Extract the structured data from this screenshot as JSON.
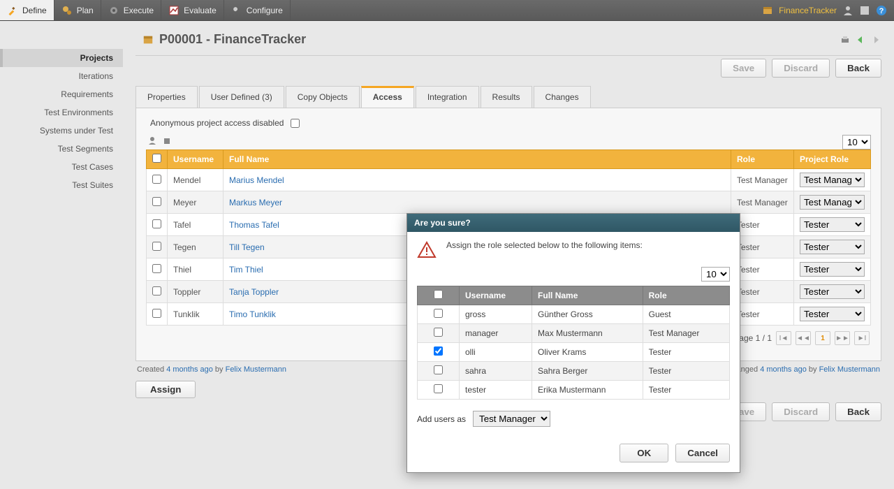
{
  "topbar": {
    "tabs": [
      {
        "label": "Define",
        "icon": "pencil",
        "active": true
      },
      {
        "label": "Plan",
        "icon": "gears",
        "active": false
      },
      {
        "label": "Execute",
        "icon": "cog",
        "active": false
      },
      {
        "label": "Evaluate",
        "icon": "chart",
        "active": false
      },
      {
        "label": "Configure",
        "icon": "wrench",
        "active": false
      }
    ],
    "project_label": "FinanceTracker"
  },
  "sidebar": {
    "items": [
      {
        "label": "Projects",
        "active": true
      },
      {
        "label": "Iterations"
      },
      {
        "label": "Requirements"
      },
      {
        "label": "Test Environments"
      },
      {
        "label": "Systems under Test"
      },
      {
        "label": "Test Segments"
      },
      {
        "label": "Test Cases"
      },
      {
        "label": "Test Suites"
      }
    ]
  },
  "page": {
    "title": "P00001 - FinanceTracker",
    "buttons": {
      "save": "Save",
      "discard": "Discard",
      "back": "Back",
      "assign": "Assign"
    }
  },
  "tabs": [
    {
      "label": "Properties"
    },
    {
      "label": "User Defined (3)"
    },
    {
      "label": "Copy Objects"
    },
    {
      "label": "Access",
      "active": true
    },
    {
      "label": "Integration"
    },
    {
      "label": "Results"
    },
    {
      "label": "Changes"
    }
  ],
  "access": {
    "anon_label": "Anonymous project access disabled",
    "page_size": "10",
    "columns": {
      "username": "Username",
      "fullname": "Full Name",
      "role": "Role",
      "project_role": "Project Role"
    },
    "rows": [
      {
        "username": "Mendel",
        "fullname": "Marius Mendel",
        "role": "Test Manager",
        "project_role": "Test Manager"
      },
      {
        "username": "Meyer",
        "fullname": "Markus Meyer",
        "role": "Test Manager",
        "project_role": "Test Manager"
      },
      {
        "username": "Tafel",
        "fullname": "Thomas Tafel",
        "role": "Tester",
        "project_role": "Tester"
      },
      {
        "username": "Tegen",
        "fullname": "Till Tegen",
        "role": "Tester",
        "project_role": "Tester"
      },
      {
        "username": "Thiel",
        "fullname": "Tim Thiel",
        "role": "Tester",
        "project_role": "Tester"
      },
      {
        "username": "Toppler",
        "fullname": "Tanja Toppler",
        "role": "Tester",
        "project_role": "Tester"
      },
      {
        "username": "Tunklik",
        "fullname": "Timo Tunklik",
        "role": "Tester",
        "project_role": "Tester"
      }
    ],
    "pagination": {
      "label": "Page 1 / 1",
      "current": "1"
    }
  },
  "meta": {
    "created_prefix": "Created ",
    "created_time": "4 months ago",
    "created_by_prefix": " by ",
    "created_by": "Felix Mustermann",
    "changed_prefix": "Last changed ",
    "changed_time": "4 months ago",
    "changed_by_prefix": " by ",
    "changed_by": "Felix Mustermann"
  },
  "dialog": {
    "title": "Are you sure?",
    "message": "Assign the role selected below to the following items:",
    "page_size": "10",
    "columns": {
      "username": "Username",
      "fullname": "Full Name",
      "role": "Role"
    },
    "rows": [
      {
        "checked": false,
        "username": "gross",
        "fullname": "Günther Gross",
        "role": "Guest"
      },
      {
        "checked": false,
        "username": "manager",
        "fullname": "Max Mustermann",
        "role": "Test Manager"
      },
      {
        "checked": true,
        "username": "olli",
        "fullname": "Oliver Krams",
        "role": "Tester"
      },
      {
        "checked": false,
        "username": "sahra",
        "fullname": "Sahra Berger",
        "role": "Tester"
      },
      {
        "checked": false,
        "username": "tester",
        "fullname": "Erika Mustermann",
        "role": "Tester"
      }
    ],
    "add_label": "Add users as",
    "add_value": "Test Manager",
    "ok": "OK",
    "cancel": "Cancel"
  }
}
